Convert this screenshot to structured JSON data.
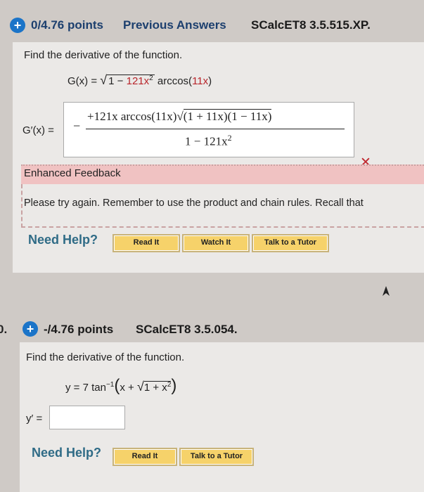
{
  "q1": {
    "points": "0/4.76 points",
    "previous_answers": "Previous Answers",
    "code": "SCalcET8 3.5.515.XP.",
    "instruction": "Find the derivative of the function.",
    "func_lhs": "G(x) =",
    "func_root_a": "1 −",
    "func_root_coef": "121x",
    "func_root_exp": "2",
    "func_arccos": "arccos(",
    "func_arccos_arg": "11x",
    "func_close": ")",
    "answer_label": "G′(x) =",
    "answer_minus": "−",
    "answer_num_a": "+121x arccos(11x)",
    "answer_num_b": "(1 + 11x)(1 − 11x)",
    "answer_den": "1 − 121x",
    "answer_den_exp": "2",
    "wrong_mark": "✕",
    "feedback_title": "Enhanced Feedback",
    "feedback_text": "Please try again. Remember to use the product and chain rules. Recall that",
    "need_help": "Need Help?",
    "buttons": [
      "Read It",
      "Watch It",
      "Talk to a Tutor"
    ]
  },
  "q2": {
    "number": "0.",
    "points": "-/4.76 points",
    "code": "SCalcET8 3.5.054.",
    "instruction": "Find the derivative of the function.",
    "func_y": "y = 7 tan",
    "func_exp": "−1",
    "func_open": "(",
    "func_x": "x +",
    "func_root": "1 + x",
    "func_root_exp": "2",
    "func_close": ")",
    "answer_label": "y′ =",
    "answer_value": "",
    "need_help": "Need Help?",
    "buttons": [
      "Read It",
      "Talk to a Tutor"
    ]
  },
  "colors": {
    "plus": "#1b74c8",
    "feedback_bg": "#f0c2c2",
    "wrong": "#c0282f",
    "button_fill": "#f6d26a",
    "need_help": "#2f6b86"
  }
}
